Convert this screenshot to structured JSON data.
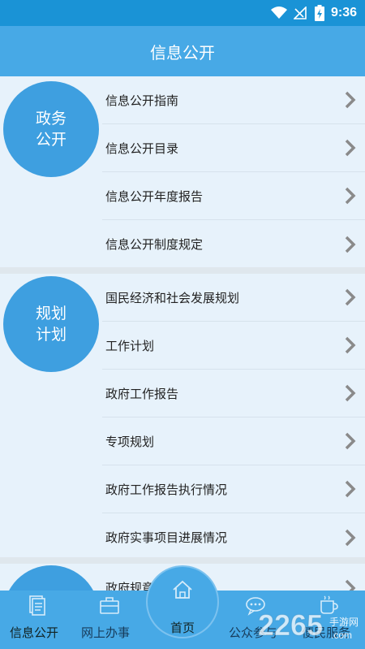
{
  "status": {
    "time": "9:36"
  },
  "header": {
    "title": "信息公开"
  },
  "sections": [
    {
      "circle_line1": "政务",
      "circle_line2": "公开",
      "items": [
        "信息公开指南",
        "信息公开目录",
        "信息公开年度报告",
        "信息公开制度规定"
      ]
    },
    {
      "circle_line1": "规划",
      "circle_line2": "计划",
      "items": [
        "国民经济和社会发展规划",
        "工作计划",
        "政府工作报告",
        "专项规划",
        "政府工作报告执行情况",
        "政府实事项目进展情况"
      ]
    },
    {
      "items": [
        "政府规章"
      ]
    }
  ],
  "tabs": {
    "info": "信息公开",
    "online": "网上办事",
    "home": "首页",
    "public": "公众参与",
    "service": "便民服务"
  },
  "watermark": {
    "number": "2265",
    "text": "手游网",
    "domain": ".com"
  },
  "colors": {
    "primary": "#47a9e6",
    "status": "#1a93d6",
    "circle": "#3e9fe0"
  }
}
